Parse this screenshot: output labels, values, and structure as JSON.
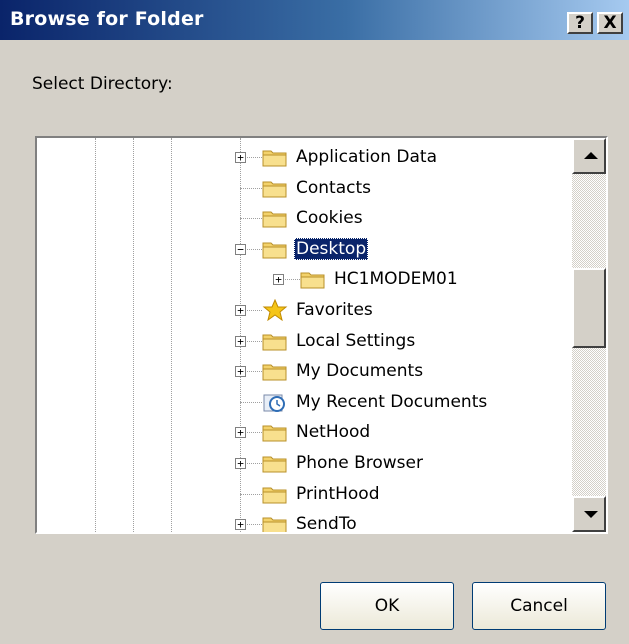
{
  "window": {
    "title": "Browse for Folder",
    "help_label": "?",
    "close_label": "X"
  },
  "prompt": "Select Directory:",
  "tree": {
    "items": [
      {
        "label": "Application Data",
        "icon": "folder-icon",
        "expander": "+",
        "level": 0,
        "selected": false
      },
      {
        "label": "Contacts",
        "icon": "folder-icon",
        "expander": "",
        "level": 0,
        "selected": false
      },
      {
        "label": "Cookies",
        "icon": "folder-icon",
        "expander": "",
        "level": 0,
        "selected": false
      },
      {
        "label": "Desktop",
        "icon": "folder-icon",
        "expander": "−",
        "level": 0,
        "selected": true
      },
      {
        "label": "HC1MODEM01",
        "icon": "folder-icon",
        "expander": "+",
        "level": 1,
        "selected": false
      },
      {
        "label": "Favorites",
        "icon": "star-icon",
        "expander": "+",
        "level": 0,
        "selected": false
      },
      {
        "label": "Local Settings",
        "icon": "folder-icon",
        "expander": "+",
        "level": 0,
        "selected": false
      },
      {
        "label": "My Documents",
        "icon": "folder-icon",
        "expander": "+",
        "level": 0,
        "selected": false
      },
      {
        "label": "My Recent Documents",
        "icon": "recent-docs-icon",
        "expander": "",
        "level": 0,
        "selected": false
      },
      {
        "label": "NetHood",
        "icon": "folder-icon",
        "expander": "+",
        "level": 0,
        "selected": false
      },
      {
        "label": "Phone Browser",
        "icon": "folder-icon",
        "expander": "+",
        "level": 0,
        "selected": false
      },
      {
        "label": "PrintHood",
        "icon": "folder-icon",
        "expander": "",
        "level": 0,
        "selected": false
      },
      {
        "label": "SendTo",
        "icon": "folder-icon",
        "expander": "+",
        "level": 0,
        "selected": false
      }
    ]
  },
  "buttons": {
    "ok": "OK",
    "cancel": "Cancel"
  },
  "colors": {
    "titlebar": "#0a246a",
    "selection": "#0a246a",
    "face": "#d4d0c8",
    "folder": "#f3d26b"
  }
}
